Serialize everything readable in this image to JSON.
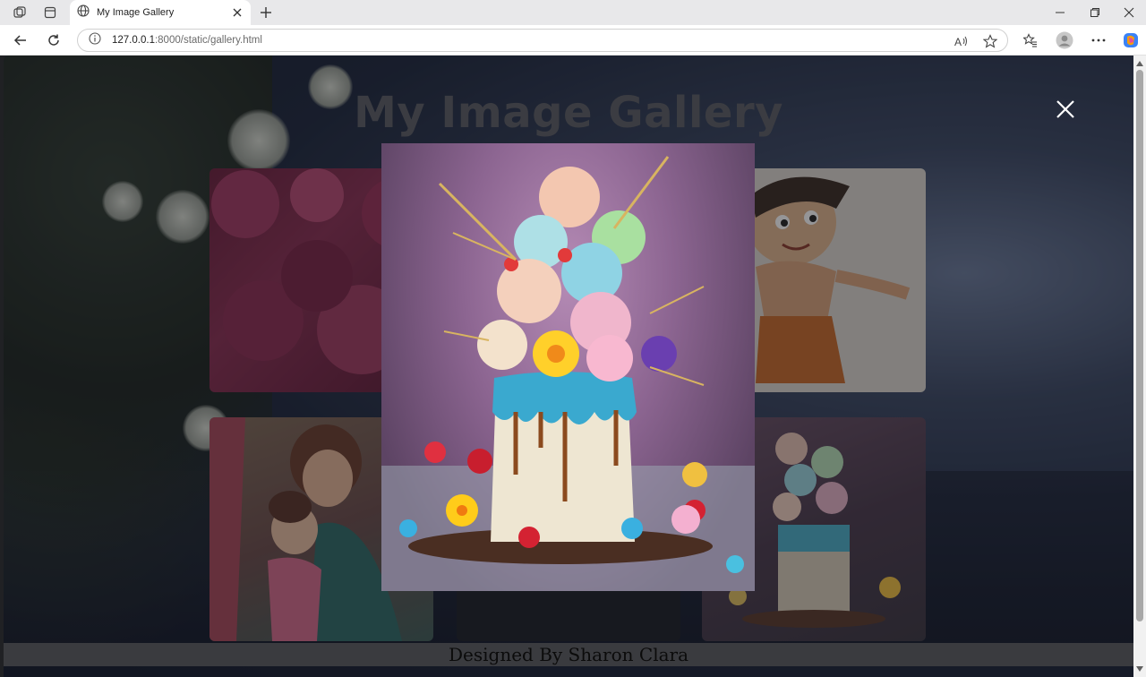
{
  "browser": {
    "tab_title": "My Image Gallery",
    "url_host": "127.0.0.1",
    "url_rest": ":8000/static/gallery.html"
  },
  "page": {
    "title": "My Image Gallery",
    "footer": "Designed By Sharon Clara"
  },
  "icons": {
    "workspaces": "workspaces-icon",
    "tab_actions": "tab-actions-icon",
    "globe": "globe-icon",
    "close": "close-icon",
    "new_tab": "plus-icon",
    "back": "back-arrow-icon",
    "refresh": "refresh-icon",
    "info": "info-icon",
    "read_aloud": "read-aloud-icon",
    "favorite": "star-icon",
    "favorites": "favorites-icon",
    "profile": "profile-icon",
    "more": "more-icon",
    "copilot": "copilot-icon"
  },
  "colors": {
    "page_title": "#5b5e64",
    "footer_bg": "#3a3b3f",
    "close_icon": "#ffffff"
  }
}
